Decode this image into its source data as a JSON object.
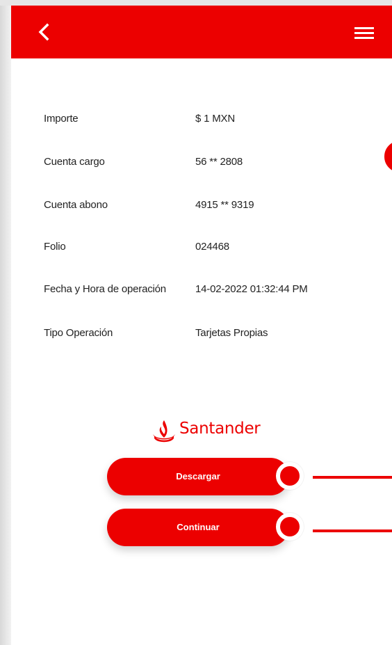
{
  "header": {
    "back_icon": "chevron-left-icon",
    "menu_icon": "hamburger-menu-icon",
    "background": "#ec0000"
  },
  "details": [
    {
      "label": "Importe",
      "value": "$ 1 MXN"
    },
    {
      "label": "Cuenta cargo",
      "value": "56 ** 2808"
    },
    {
      "label": "Cuenta abono",
      "value": "4915 ** 9319"
    },
    {
      "label": "Folio",
      "value": "024468"
    },
    {
      "label": "Fecha y Hora de operación",
      "value": "14-02-2022 01:32:44 PM"
    },
    {
      "label": "Tipo Operación",
      "value": "Tarjetas Propias"
    }
  ],
  "brand": {
    "name": "Santander",
    "icon": "santander-flame-icon",
    "color": "#ec0000"
  },
  "buttons": {
    "download_label": "Descargar",
    "continue_label": "Continuar"
  },
  "annotations": {
    "color": "#ec0000"
  }
}
